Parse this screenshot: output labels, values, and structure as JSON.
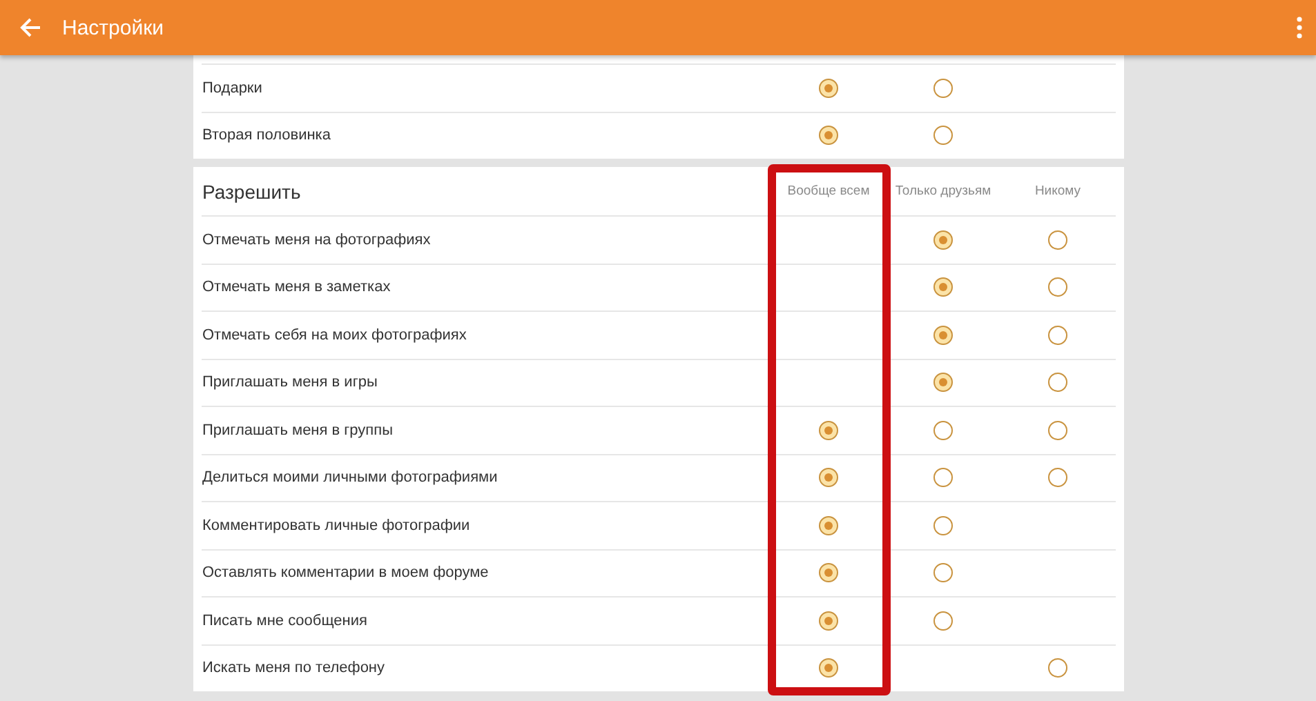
{
  "app_bar": {
    "title": "Настройки"
  },
  "top_card": {
    "rows": [
      {
        "label": "Подарки",
        "options": [
          {
            "kind": "radio",
            "selected": true
          },
          {
            "kind": "radio",
            "selected": false
          },
          {
            "kind": "empty"
          }
        ]
      },
      {
        "label": "Вторая половинка",
        "options": [
          {
            "kind": "radio",
            "selected": true
          },
          {
            "kind": "radio",
            "selected": false
          },
          {
            "kind": "empty"
          }
        ]
      }
    ]
  },
  "permissions": {
    "title": "Разрешить",
    "columns": [
      {
        "label": "Вообще всем",
        "highlighted": true
      },
      {
        "label": "Только друзьям",
        "highlighted": false
      },
      {
        "label": "Никому",
        "highlighted": false
      }
    ],
    "rows": [
      {
        "label": "Отмечать меня на фотографиях",
        "options": [
          {
            "kind": "empty"
          },
          {
            "kind": "radio",
            "selected": true
          },
          {
            "kind": "radio",
            "selected": false
          }
        ]
      },
      {
        "label": "Отмечать меня в заметках",
        "options": [
          {
            "kind": "empty"
          },
          {
            "kind": "radio",
            "selected": true
          },
          {
            "kind": "radio",
            "selected": false
          }
        ]
      },
      {
        "label": "Отмечать себя на моих фотографиях",
        "options": [
          {
            "kind": "empty"
          },
          {
            "kind": "radio",
            "selected": true
          },
          {
            "kind": "radio",
            "selected": false
          }
        ]
      },
      {
        "label": "Приглашать меня в игры",
        "options": [
          {
            "kind": "empty"
          },
          {
            "kind": "radio",
            "selected": true
          },
          {
            "kind": "radio",
            "selected": false
          }
        ]
      },
      {
        "label": "Приглашать меня в группы",
        "options": [
          {
            "kind": "radio",
            "selected": true
          },
          {
            "kind": "radio",
            "selected": false
          },
          {
            "kind": "radio",
            "selected": false
          }
        ]
      },
      {
        "label": "Делиться моими личными фотографиями",
        "options": [
          {
            "kind": "radio",
            "selected": true
          },
          {
            "kind": "radio",
            "selected": false
          },
          {
            "kind": "radio",
            "selected": false
          }
        ]
      },
      {
        "label": "Комментировать личные фотографии",
        "options": [
          {
            "kind": "radio",
            "selected": true
          },
          {
            "kind": "radio",
            "selected": false
          },
          {
            "kind": "empty"
          }
        ]
      },
      {
        "label": "Оставлять комментарии в моем форуме",
        "options": [
          {
            "kind": "radio",
            "selected": true
          },
          {
            "kind": "radio",
            "selected": false
          },
          {
            "kind": "empty"
          }
        ]
      },
      {
        "label": "Писать мне сообщения",
        "options": [
          {
            "kind": "radio",
            "selected": true
          },
          {
            "kind": "radio",
            "selected": false
          },
          {
            "kind": "empty"
          }
        ]
      },
      {
        "label": "Искать меня по телефону",
        "options": [
          {
            "kind": "radio",
            "selected": true
          },
          {
            "kind": "empty"
          },
          {
            "kind": "radio",
            "selected": false
          }
        ]
      }
    ]
  }
}
